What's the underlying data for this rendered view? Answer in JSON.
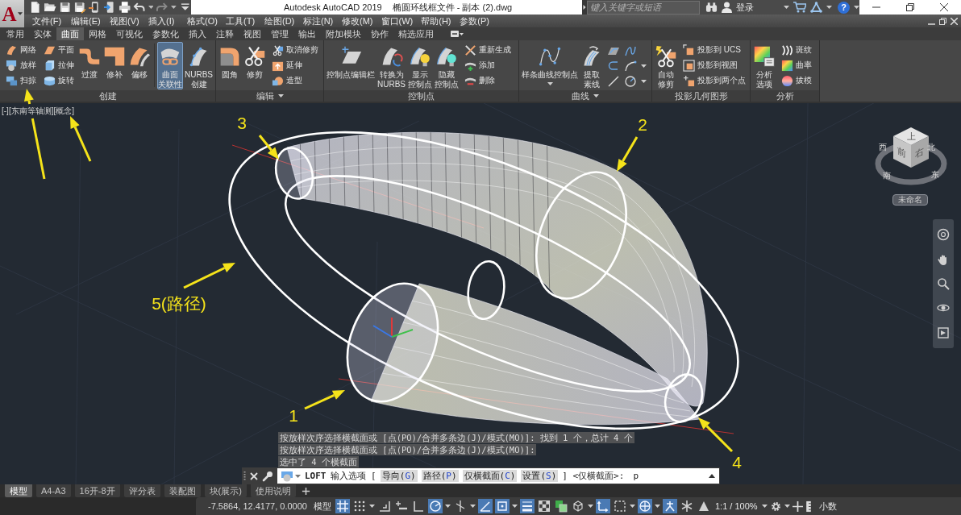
{
  "title_bar": {
    "app_button": "A",
    "app_title": "Autodesk AutoCAD 2019",
    "file_name": "椭圆环线框文件 - 副本 (2).dwg",
    "search": {
      "placeholder": "键入关键字或短语"
    },
    "sign_in": "登录",
    "help": "?"
  },
  "menu_bar": [
    "文件(F)",
    "编辑(E)",
    "视图(V)",
    "插入(I)",
    "格式(O)",
    "工具(T)",
    "绘图(D)",
    "标注(N)",
    "修改(M)",
    "窗口(W)",
    "帮助(H)",
    "参数(P)"
  ],
  "ribbon": {
    "tabs": [
      {
        "label": "常用",
        "selected": false
      },
      {
        "label": "实体",
        "selected": false
      },
      {
        "label": "曲面",
        "selected": true
      },
      {
        "label": "网格",
        "selected": false
      },
      {
        "label": "可视化",
        "selected": false
      },
      {
        "label": "参数化",
        "selected": false
      },
      {
        "label": "插入",
        "selected": false
      },
      {
        "label": "注释",
        "selected": false
      },
      {
        "label": "视图",
        "selected": false
      },
      {
        "label": "管理",
        "selected": false
      },
      {
        "label": "输出",
        "selected": false
      },
      {
        "label": "附加模块",
        "selected": false
      },
      {
        "label": "协作",
        "selected": false
      },
      {
        "label": "精选应用",
        "selected": false
      }
    ],
    "panels": [
      {
        "title": "创建",
        "menu": false,
        "items": [
          {
            "kind": "stack",
            "buttons": [
              {
                "label": "网络",
                "on": false
              },
              {
                "label": "放样",
                "on": false
              },
              {
                "label": "扫掠",
                "on": false
              }
            ]
          },
          {
            "kind": "stack",
            "buttons": [
              {
                "label": "平面",
                "on": false
              },
              {
                "label": "拉伸",
                "on": false
              },
              {
                "label": "旋转",
                "on": false
              }
            ]
          },
          {
            "kind": "large",
            "lines": [
              "过渡"
            ],
            "on": false,
            "dropdown": false
          },
          {
            "kind": "large",
            "lines": [
              "修补"
            ],
            "on": false,
            "dropdown": false
          },
          {
            "kind": "large",
            "lines": [
              "偏移"
            ],
            "on": false,
            "dropdown": false
          },
          {
            "kind": "separator"
          },
          {
            "kind": "large",
            "lines": [
              "曲面",
              "关联性"
            ],
            "on": true,
            "dropdown": false
          },
          {
            "kind": "large",
            "lines": [
              "NURBS",
              "创建"
            ],
            "on": false,
            "dropdown": false
          }
        ]
      },
      {
        "title": "编辑",
        "menu": true,
        "items": [
          {
            "kind": "large",
            "lines": [
              "圆角"
            ],
            "on": false,
            "dropdown": false
          },
          {
            "kind": "large",
            "lines": [
              "修剪"
            ],
            "on": false,
            "dropdown": false
          },
          {
            "kind": "stack",
            "buttons": [
              {
                "label": "取消修剪",
                "on": false
              },
              {
                "label": "延伸",
                "on": false
              },
              {
                "label": "造型",
                "on": false
              }
            ]
          }
        ]
      },
      {
        "title": "控制点",
        "menu": false,
        "items": [
          {
            "kind": "large",
            "lines": [
              "控制点编辑栏"
            ],
            "on": false,
            "dropdown": false
          },
          {
            "kind": "large",
            "lines": [
              "转换为",
              "NURBS"
            ],
            "on": false,
            "dropdown": false
          },
          {
            "kind": "large",
            "lines": [
              "显示",
              "控制点"
            ],
            "on": false,
            "dropdown": false
          },
          {
            "kind": "large",
            "lines": [
              "隐藏",
              "控制点"
            ],
            "on": false,
            "dropdown": false
          },
          {
            "kind": "stack",
            "buttons": [
              {
                "label": "重新生成",
                "on": false
              },
              {
                "label": "添加",
                "on": false
              },
              {
                "label": "删除",
                "on": false
              }
            ]
          }
        ]
      },
      {
        "title": "曲线",
        "menu": true,
        "items": [
          {
            "kind": "large",
            "lines": [
              "样条曲线控制点"
            ],
            "on": false,
            "dropdown": true
          },
          {
            "kind": "large",
            "lines": [
              "提取",
              "素线"
            ],
            "on": false,
            "dropdown": false
          },
          {
            "kind": "icon_grid",
            "rows": [
              {
                "dropdown": false
              },
              {
                "dropdown": true
              },
              {
                "dropdown": true
              }
            ]
          }
        ]
      },
      {
        "title": "投影几何图形",
        "menu": false,
        "items": [
          {
            "kind": "large",
            "lines": [
              "自动",
              "修剪"
            ],
            "on": false,
            "dropdown": false
          },
          {
            "kind": "stack",
            "buttons": [
              {
                "label": "投影到 UCS",
                "on": false
              },
              {
                "label": "投影到视图",
                "on": false
              },
              {
                "label": "投影到两个点",
                "on": false
              }
            ]
          }
        ]
      },
      {
        "title": "分析",
        "menu": false,
        "items": [
          {
            "kind": "large",
            "lines": [
              "分析",
              "选项"
            ],
            "on": false,
            "dropdown": false
          },
          {
            "kind": "stack",
            "buttons": [
              {
                "label": "斑纹",
                "on": false
              },
              {
                "label": "曲率",
                "on": false
              },
              {
                "label": "拔模",
                "on": false
              }
            ]
          }
        ]
      }
    ]
  },
  "viewport": {
    "view_controls": [
      "[-]",
      "[东南等轴测]",
      "[概念]"
    ],
    "view_cube": {
      "faces": [
        "上",
        "前",
        "右"
      ],
      "compass": [
        "西",
        "北",
        "南",
        "东"
      ],
      "menu": "未命名"
    },
    "command_history": [
      "按放样次序选择横截面或 [点(PO)/合并多条边(J)/模式(MO)]: 找到 1 个，总计 4 个",
      "按放样次序选择横截面或 [点(PO)/合并多条边(J)/模式(MO)]:",
      "选中了 4 个横截面"
    ],
    "command_line": {
      "command": "LOFT",
      "prompt": "输入选项 [",
      "options": [
        {
          "label": "导向(",
          "key": "G",
          "end": ")"
        },
        {
          "label": "路径(",
          "key": "P",
          "end": ")"
        },
        {
          "label": "仅横截面(",
          "key": "C",
          "end": ")"
        },
        {
          "label": "设置(",
          "key": "S",
          "end": ")"
        }
      ],
      "suffix": "] <仅横截面>:",
      "value": "p"
    }
  },
  "annotations": [
    "3",
    "2",
    "5(路径)",
    "1",
    "4"
  ],
  "layout_tabs": [
    {
      "label": "模型",
      "selected": true
    },
    {
      "label": "A4-A3",
      "selected": false
    },
    {
      "label": "16开-8开",
      "selected": false
    },
    {
      "label": "评分表",
      "selected": false
    },
    {
      "label": "装配图",
      "selected": false
    },
    {
      "label": "块(展示)",
      "selected": false
    },
    {
      "label": "使用说明",
      "selected": false
    }
  ],
  "status_bar": {
    "coordinates": "-7.5864, 12.4177, 0.0000",
    "space": "模型",
    "toggles": [
      {
        "on": true,
        "dropdown": false
      },
      {
        "on": false,
        "dropdown": true
      },
      {
        "on": false,
        "dropdown": false
      },
      {
        "on": false,
        "dropdown": false
      },
      {
        "on": false,
        "dropdown": false
      },
      {
        "on": true,
        "dropdown": true
      },
      {
        "on": false,
        "dropdown": true
      },
      {
        "on": true,
        "dropdown": false
      },
      {
        "on": true,
        "dropdown": true
      },
      {
        "on": true,
        "dropdown": false
      },
      {
        "on": false,
        "dropdown": false
      },
      {
        "on": false,
        "dropdown": false
      },
      {
        "on": false,
        "dropdown": true
      },
      {
        "on": true,
        "dropdown": false
      },
      {
        "on": false,
        "dropdown": true
      },
      {
        "on": true,
        "dropdown": true
      },
      {
        "on": true,
        "dropdown": false
      },
      {
        "on": false,
        "dropdown": false
      },
      {
        "on": false,
        "dropdown": false
      }
    ],
    "annotation_scale": "1:1 / 100%",
    "units": "小数"
  }
}
